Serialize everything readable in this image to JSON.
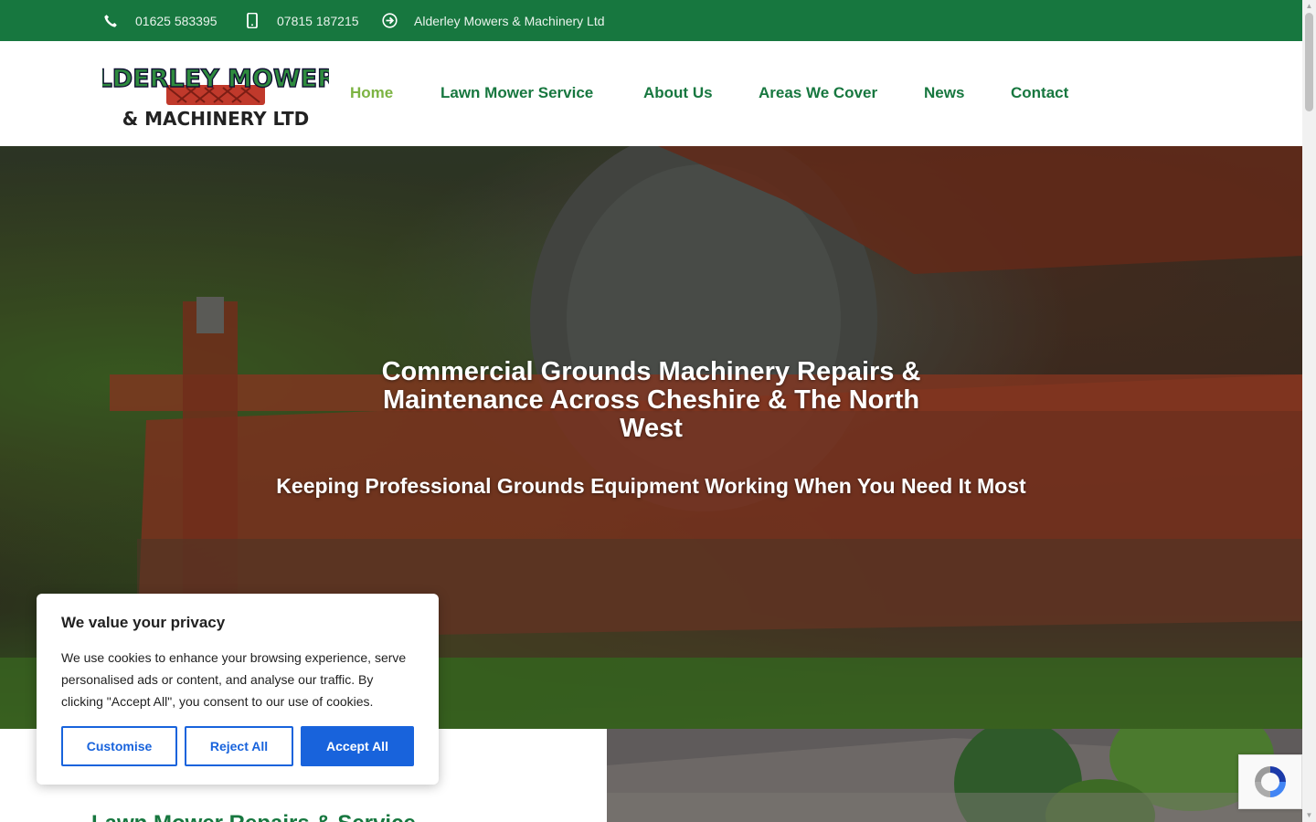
{
  "topbar": {
    "phone_landline": "01625 583395",
    "phone_mobile": "07815 187215",
    "company": "Alderley Mowers & Machinery Ltd",
    "icons": [
      "phone-icon",
      "mobile-icon",
      "arrow-circle-right-icon"
    ]
  },
  "logo": {
    "line1": "ALDERLEY MOWERS",
    "line2": "& MACHINERY LTD"
  },
  "nav": {
    "items": [
      {
        "label": "Home",
        "active": true
      },
      {
        "label": "Lawn Mower Service",
        "active": false
      },
      {
        "label": "About Us",
        "active": false
      },
      {
        "label": "Areas We Cover",
        "active": false
      },
      {
        "label": "News",
        "active": false
      },
      {
        "label": "Contact",
        "active": false
      }
    ]
  },
  "hero": {
    "title": "Commercial Grounds Machinery Repairs & Maintenance Across Cheshire & The North West",
    "subtitle": "Keeping Professional Grounds Equipment Working When You Need It Most"
  },
  "section": {
    "heading": "Lawn Mower Repairs & Service"
  },
  "cookie": {
    "title": "We value your privacy",
    "body": "We use cookies to enhance your browsing experience, serve personalised ads or content, and analyse our traffic. By clicking \"Accept All\", you consent to our use of cookies.",
    "customise_label": "Customise",
    "reject_label": "Reject All",
    "accept_label": "Accept All"
  },
  "colors": {
    "brand_green": "#17773f",
    "nav_active": "#7cb342",
    "cookie_blue": "#1863dc",
    "logo_red": "#c0392b"
  }
}
